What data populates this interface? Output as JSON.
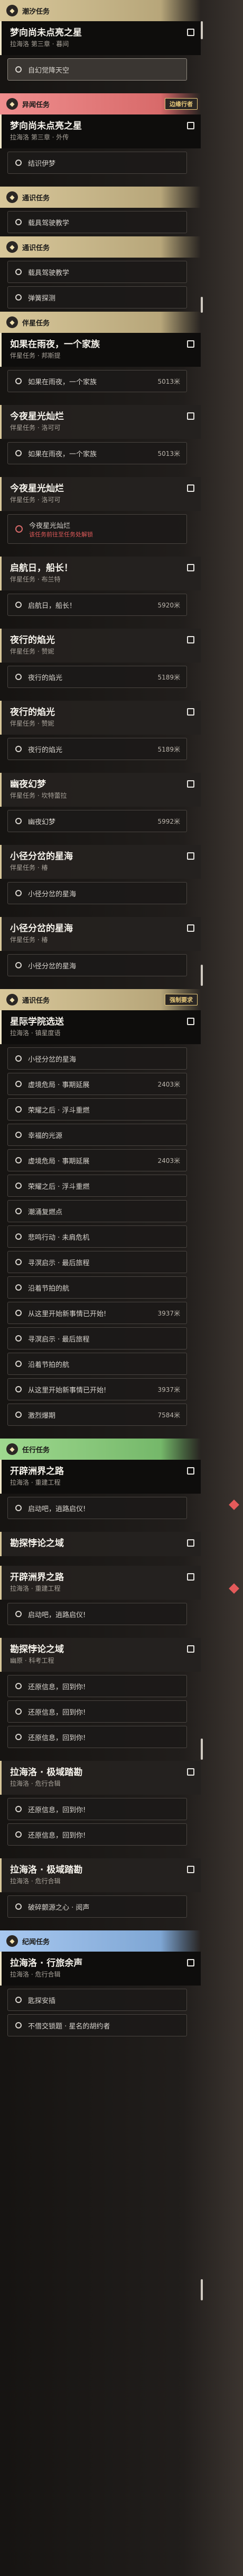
{
  "colors": {
    "gold": "#d8c79a",
    "red": "#ef8e8e",
    "sky": "#8fe0dc",
    "green": "#9fd98f",
    "blue": "#a8c8f0",
    "warn": "#e05a5a"
  },
  "sections": [
    {
      "category": "潮汐任务",
      "quests": [
        {
          "title": "梦向尚未点亮之星",
          "subtitle": "拉海洛 第三章 · 暮间",
          "steps": [
            {
              "label": "自幻觉降天空",
              "active": true
            }
          ]
        }
      ]
    },
    {
      "category": "异闻任务",
      "quests": [
        {
          "title": "梦向尚未点亮之星",
          "subtitle": "拉海洛 第三章 · 外传",
          "steps": [
            {
              "label": "结识伊梦"
            }
          ]
        }
      ],
      "tag": "边缘行者"
    },
    {
      "category": "通识任务",
      "quests": [],
      "steps": [
        {
          "label": "载具驾驶教学"
        }
      ]
    },
    {
      "category": "通识任务",
      "quests": [],
      "steps": [
        {
          "label": "载具驾驶教学"
        },
        {
          "label": "弹簧探测"
        }
      ]
    },
    {
      "category": "伴星任务",
      "quests": [
        {
          "title": "如果在雨夜，一个家族",
          "subtitle": "伴星任务 · 邦斯提",
          "steps": [
            {
              "label": "如果在雨夜，一个家族",
              "dist": "5013米"
            }
          ]
        },
        {
          "title": "今夜星光灿烂",
          "subtitle": "伴星任务 · 洛可可",
          "steps": [
            {
              "label": "如果在雨夜，一个家族",
              "dist": "5013米"
            }
          ]
        },
        {
          "title": "今夜星光灿烂",
          "subtitle": "伴星任务 · 洛可可",
          "steps": [
            {
              "label": "今夜星光灿烂",
              "locked": true,
              "warn": "该任务前往至任务处解锁"
            }
          ]
        },
        {
          "title": "启航日，船长！",
          "subtitle": "伴星任务 · 布兰特",
          "steps": [
            {
              "label": "启航日，船长！",
              "dist": "5920米"
            }
          ]
        },
        {
          "title": "夜行的焰光",
          "subtitle": "伴星任务 · 赞妮",
          "steps": [
            {
              "label": "夜行的焰光",
              "dist": "5189米"
            }
          ]
        },
        {
          "title": "夜行的焰光",
          "subtitle": "伴星任务 · 赞妮",
          "steps": [
            {
              "label": "夜行的焰光",
              "dist": "5189米"
            }
          ]
        },
        {
          "title": "幽夜幻梦",
          "subtitle": "伴星任务 · 坎特蕾拉",
          "steps": [
            {
              "label": "幽夜幻梦",
              "dist": "5992米"
            }
          ]
        },
        {
          "title": "小径分岔的星海",
          "subtitle": "伴星任务 · 椿",
          "steps": [
            {
              "label": "小径分岔的星海"
            }
          ]
        },
        {
          "title": "小径分岔的星海",
          "subtitle": "伴星任务 · 椿",
          "steps": [
            {
              "label": "小径分岔的星海"
            }
          ]
        }
      ]
    },
    {
      "category": "通识任务",
      "tag": "强制要求",
      "quests": [
        {
          "title": "星际学院选送",
          "subtitle": "拉海洛 · 镇星度语",
          "steps": [
            {
              "label": "小径分岔的星海"
            },
            {
              "label": "虚境危局 · 事期延展",
              "dist": "2403米"
            },
            {
              "label": "荣耀之后 · 浮斗重燃"
            },
            {
              "label": "幸福的光源"
            },
            {
              "label": "虚境危局 · 事期延展",
              "dist": "2403米"
            },
            {
              "label": "荣耀之后 · 浮斗重燃"
            },
            {
              "label": "潮涌复燃点"
            },
            {
              "label": "悲鸣行动 · 未肩危机"
            },
            {
              "label": "寻溟启示 · 最后旅程"
            },
            {
              "label": "沿着节拍的航"
            },
            {
              "label": "从这里开始新事情已开始!",
              "dist": "3937米"
            },
            {
              "label": "寻溟启示 · 最后旅程"
            },
            {
              "label": "沿着节拍的航"
            },
            {
              "label": "从这里开始新事情已开始!",
              "dist": "3937米"
            },
            {
              "label": "激烈爆期",
              "dist": "7584米"
            }
          ]
        }
      ]
    },
    {
      "category": "任行任务",
      "quests": [
        {
          "title": "开辟洲界之路",
          "subtitle": "拉海洛 · 重建工程",
          "steps": [
            {
              "label": "启动吧，逍路启仪!"
            }
          ]
        },
        {
          "title": "勘探悖论之域",
          "subtitle": "",
          "steps": []
        },
        {
          "title": "开辟洲界之路",
          "subtitle": "拉海洛 · 重建工程",
          "steps": [
            {
              "label": "启动吧，逍路启仪!"
            }
          ]
        },
        {
          "title": "勘探悖论之域",
          "subtitle": "幽原 · 科考工程",
          "steps": [
            {
              "label": "还原信息，回到你!"
            },
            {
              "label": "还原信息，回到你!"
            },
            {
              "label": "还原信息，回到你!"
            }
          ]
        },
        {
          "title": "拉海洛 · 极域踏勘",
          "subtitle": "拉海洛 · 危行合辑",
          "steps": [
            {
              "label": "还原信息，回到你!"
            },
            {
              "label": "还原信息，回到你!"
            }
          ]
        },
        {
          "title": "拉海洛 · 极域踏勘",
          "subtitle": "拉海洛 · 危行合辑",
          "steps": [
            {
              "label": "破碎颤源之心 · 阅声"
            }
          ]
        }
      ]
    },
    {
      "category": "纪闻任务",
      "quests": [
        {
          "title": "拉海洛 · 行旅余声",
          "subtitle": "拉海洛 · 危行合辑",
          "steps": [
            {
              "label": "匙探安插"
            },
            {
              "label": "不借交锁题 · 星名的胡约者"
            }
          ]
        }
      ]
    }
  ]
}
